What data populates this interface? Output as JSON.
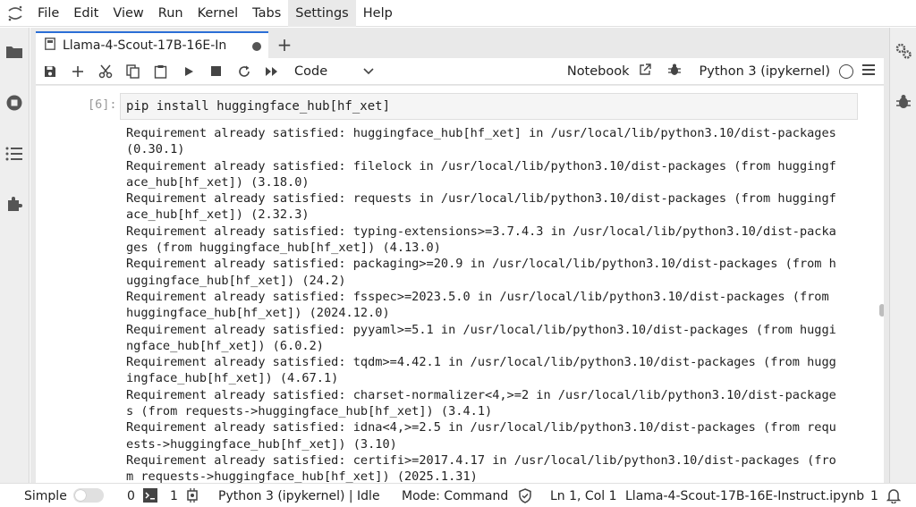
{
  "menubar": {
    "items": [
      "File",
      "Edit",
      "View",
      "Run",
      "Kernel",
      "Tabs",
      "Settings",
      "Help"
    ],
    "active_index": 6
  },
  "tab": {
    "title": "Llama-4-Scout-17B-16E-In"
  },
  "toolbar": {
    "cell_type": "Code",
    "notebook_label": "Notebook",
    "kernel_name": "Python 3 (ipykernel)"
  },
  "cell": {
    "prompt": "[6]:",
    "code": "pip install huggingface_hub[hf_xet]",
    "output_lines": [
      "Requirement already satisfied: huggingface_hub[hf_xet] in /usr/local/lib/python3.10/dist-packages",
      "(0.30.1)",
      "Requirement already satisfied: filelock in /usr/local/lib/python3.10/dist-packages (from huggingf",
      "ace_hub[hf_xet]) (3.18.0)",
      "Requirement already satisfied: requests in /usr/local/lib/python3.10/dist-packages (from huggingf",
      "ace_hub[hf_xet]) (2.32.3)",
      "Requirement already satisfied: typing-extensions>=3.7.4.3 in /usr/local/lib/python3.10/dist-packa",
      "ges (from huggingface_hub[hf_xet]) (4.13.0)",
      "Requirement already satisfied: packaging>=20.9 in /usr/local/lib/python3.10/dist-packages (from h",
      "uggingface_hub[hf_xet]) (24.2)",
      "Requirement already satisfied: fsspec>=2023.5.0 in /usr/local/lib/python3.10/dist-packages (from",
      "huggingface_hub[hf_xet]) (2024.12.0)",
      "Requirement already satisfied: pyyaml>=5.1 in /usr/local/lib/python3.10/dist-packages (from huggi",
      "ngface_hub[hf_xet]) (6.0.2)",
      "Requirement already satisfied: tqdm>=4.42.1 in /usr/local/lib/python3.10/dist-packages (from hugg",
      "ingface_hub[hf_xet]) (4.67.1)",
      "Requirement already satisfied: charset-normalizer<4,>=2 in /usr/local/lib/python3.10/dist-package",
      "s (from requests->huggingface_hub[hf_xet]) (3.4.1)",
      "Requirement already satisfied: idna<4,>=2.5 in /usr/local/lib/python3.10/dist-packages (from requ",
      "ests->huggingface_hub[hf_xet]) (3.10)",
      "Requirement already satisfied: certifi>=2017.4.17 in /usr/local/lib/python3.10/dist-packages (fro",
      "m requests->huggingface_hub[hf_xet]) (2025.1.31)"
    ]
  },
  "statusbar": {
    "mode_label": "Simple",
    "terminals_count": "0",
    "kernels_count": "1",
    "kernel_status": "Python 3 (ipykernel) | Idle",
    "mode": "Mode: Command",
    "cursor": "Ln 1, Col 1",
    "filename": "Llama-4-Scout-17B-16E-Instruct.ipynb",
    "notifications": "1"
  },
  "colors": {
    "accent": "#2b6fd6",
    "sidebar_bg": "#eeeeee",
    "input_bg": "#f5f5f5"
  },
  "icons": [
    "folder-icon",
    "running-icon",
    "toc-icon",
    "extension-icon",
    "property-inspector-icon",
    "debugger-icon"
  ]
}
